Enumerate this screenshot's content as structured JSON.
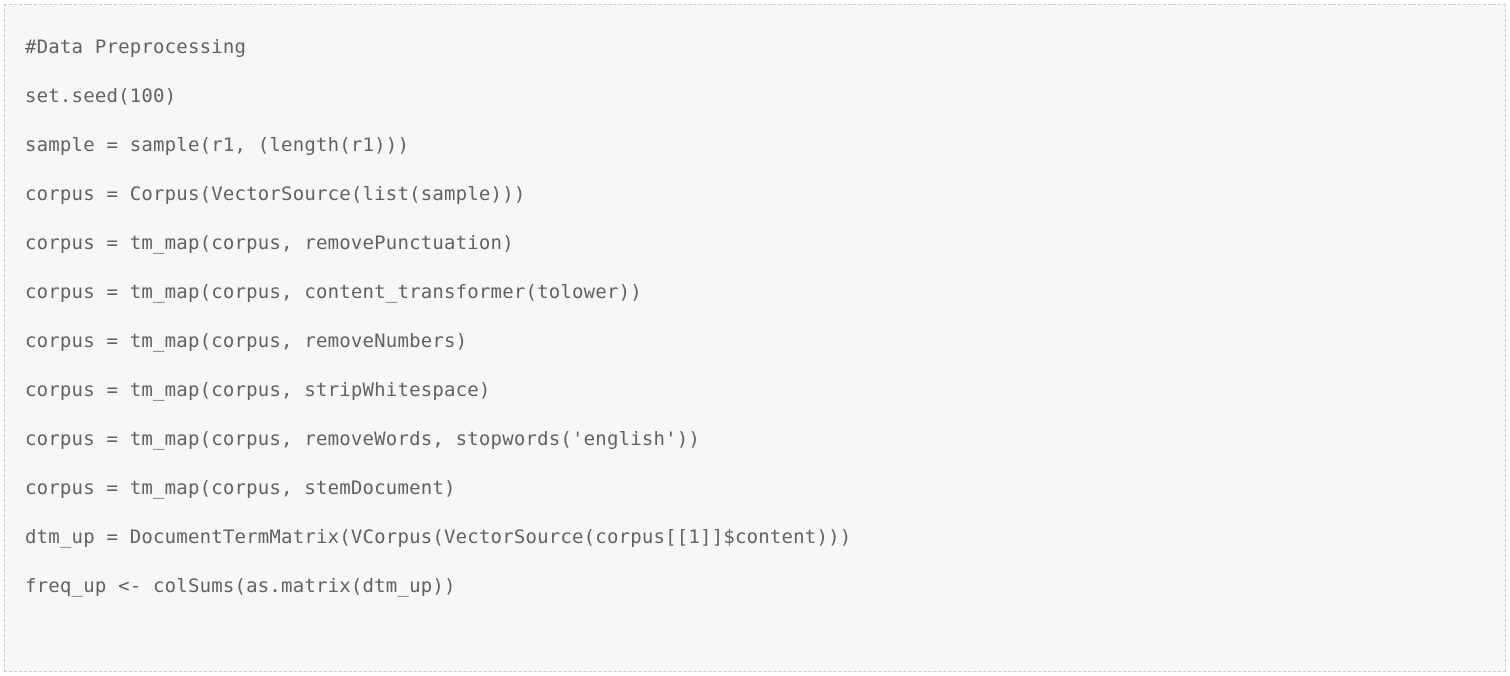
{
  "code": {
    "lines": [
      "#Data Preprocessing",
      "set.seed(100)",
      "sample = sample(r1, (length(r1)))",
      "corpus = Corpus(VectorSource(list(sample)))",
      "corpus = tm_map(corpus, removePunctuation)",
      "corpus = tm_map(corpus, content_transformer(tolower))",
      "corpus = tm_map(corpus, removeNumbers)",
      "corpus = tm_map(corpus, stripWhitespace)",
      "corpus = tm_map(corpus, removeWords, stopwords('english'))",
      "corpus = tm_map(corpus, stemDocument)",
      "dtm_up = DocumentTermMatrix(VCorpus(VectorSource(corpus[[1]]$content)))",
      "freq_up <- colSums(as.matrix(dtm_up))"
    ]
  }
}
